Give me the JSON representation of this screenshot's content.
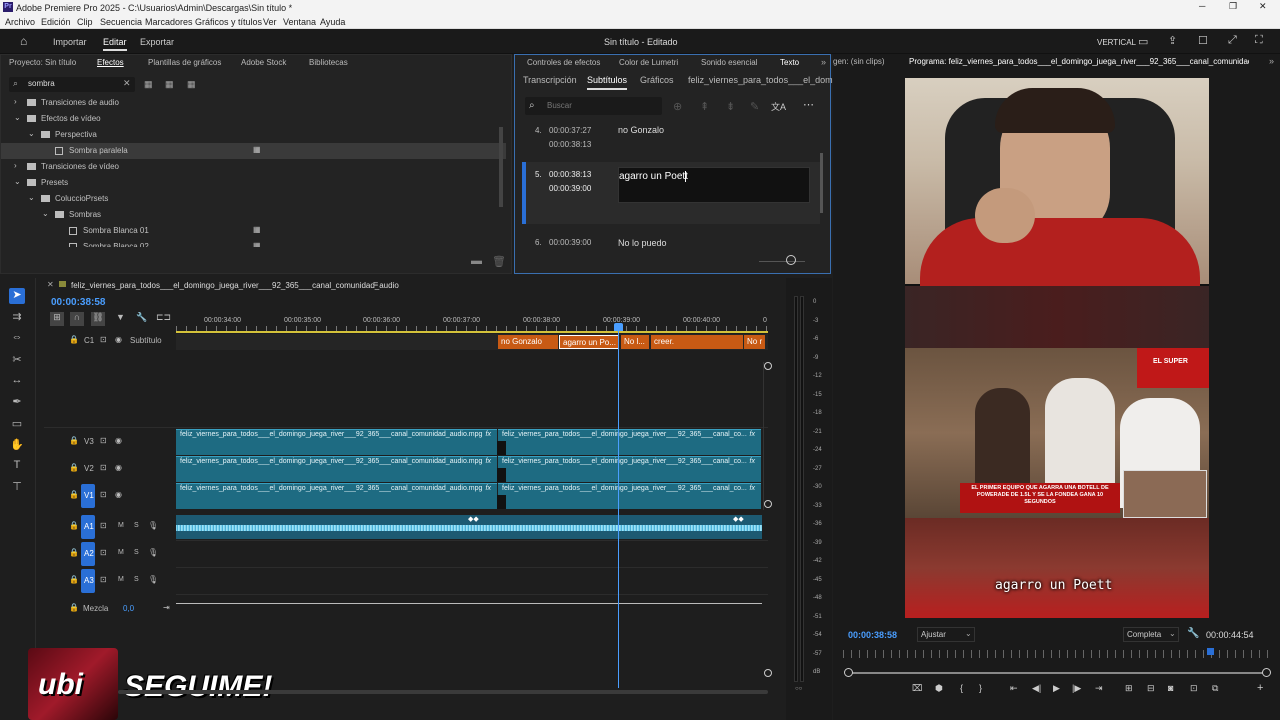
{
  "window": {
    "title": "Adobe Premiere Pro 2025 - C:\\Usuarios\\Admin\\Descargas\\Sin título *"
  },
  "menu": [
    "Archivo",
    "Edición",
    "Clip",
    "Secuencia",
    "Marcadores",
    "Gráficos y títulos",
    "Ver",
    "Ventana",
    "Ayuda"
  ],
  "workspace": {
    "tabs": [
      "Importar",
      "Editar",
      "Exportar"
    ],
    "active": "Editar",
    "doc_title": "Sin título - Editado",
    "layout": "VERTICAL"
  },
  "effects_panel": {
    "tabs": [
      "Proyecto: Sin título",
      "Efectos",
      "Plantillas de gráficos",
      "Adobe Stock",
      "Bibliotecas"
    ],
    "search": "sombra",
    "tree": [
      {
        "label": "Transiciones de audio",
        "indent": 0,
        "caret": "›"
      },
      {
        "label": "Efectos de vídeo",
        "indent": 0,
        "caret": "⌄"
      },
      {
        "label": "Perspectiva",
        "indent": 1,
        "caret": "⌄"
      },
      {
        "label": "Sombra paralela",
        "indent": 2,
        "caret": ""
      },
      {
        "label": "Transiciones de vídeo",
        "indent": 0,
        "caret": "›"
      },
      {
        "label": "Presets",
        "indent": 0,
        "caret": "⌄"
      },
      {
        "label": "ColuccioPrsets",
        "indent": 1,
        "caret": "⌄"
      },
      {
        "label": "Sombras",
        "indent": 2,
        "caret": "⌄"
      },
      {
        "label": "Sombra Blanca 01",
        "indent": 3,
        "caret": ""
      },
      {
        "label": "Sombra Blanca 02",
        "indent": 3,
        "caret": ""
      }
    ]
  },
  "text_panel": {
    "tabs": [
      "Controles de efectos",
      "Color de Lumetri",
      "Sonido esencial",
      "Texto"
    ],
    "subtabs": [
      "Transcripción",
      "Subtítulos",
      "Gráficos",
      "feliz_viernes_para_todos___el_domi"
    ],
    "search_placeholder": "Buscar",
    "captions": [
      {
        "n": "4.",
        "in": "00:00:37:27",
        "out": "00:00:38:13",
        "text": "no Gonzalo"
      },
      {
        "n": "5.",
        "in": "00:00:38:13",
        "out": "00:00:39:00",
        "text": "agarro un Poett"
      },
      {
        "n": "6.",
        "in": "00:00:39:00",
        "out": "",
        "text": "No lo puedo"
      }
    ]
  },
  "program": {
    "source_tab": "gen: (sin clips)",
    "title": "Programa: feliz_viernes_para_todos___el_domingo_juega_river___92_365___canal_comunidad_audio",
    "timecode": "00:00:38:58",
    "fit": "Ajustar",
    "quality": "Completa",
    "duration": "00:00:44:54",
    "caption_overlay": "agarro un Poett",
    "banner1": "EL SUPER",
    "banner2": "EL PRIMER EQUIPO QUE AGARRA UNA BOTELL DE POWERADE DE 1.5L Y SE LA FONDEA GANA 10 SEGUNDOS"
  },
  "timeline": {
    "tab": "feliz_viernes_para_todos___el_domingo_juega_river___92_365___canal_comunidad_audio",
    "timecode": "00:00:38:58",
    "ruler": [
      "00:00:34:00",
      "00:00:35:00",
      "00:00:36:00",
      "00:00:37:00",
      "00:00:38:00",
      "00:00:39:00",
      "00:00:40:00",
      "0"
    ],
    "subtitle_track": "Subtítulo",
    "subtitle_clips": [
      "no Gonzalo",
      "agarro un Po...",
      "No l...",
      "creer.",
      "No r"
    ],
    "video_tracks": [
      "V3",
      "V2",
      "V1"
    ],
    "audio_tracks": [
      "A1",
      "A2",
      "A3"
    ],
    "clip_name": "feliz_viernes_para_todos___el_domingo_juega_river___92_365___canal_comunidad_audio.mpg",
    "clip_name_short": "feliz_viernes_para_todos___el_domingo_juega_river___92_365___canal_co...",
    "mix_label": "Mezcla",
    "mix_value": "0,0"
  },
  "meter": {
    "labels": [
      "0",
      "-3",
      "-6",
      "-9",
      "-12",
      "-15",
      "-18",
      "-21",
      "-24",
      "-27",
      "-30",
      "-33",
      "-36",
      "-39",
      "-42",
      "-45",
      "-48",
      "-51",
      "-54",
      "-57",
      "dB"
    ]
  },
  "overlay": {
    "brand": "ubi",
    "cta": "SEGUIME!"
  },
  "colors": {
    "accent": "#2a6fd6",
    "clip": "#1e6b82",
    "subtitle": "#c85a14",
    "timecode": "#4a9eff"
  }
}
